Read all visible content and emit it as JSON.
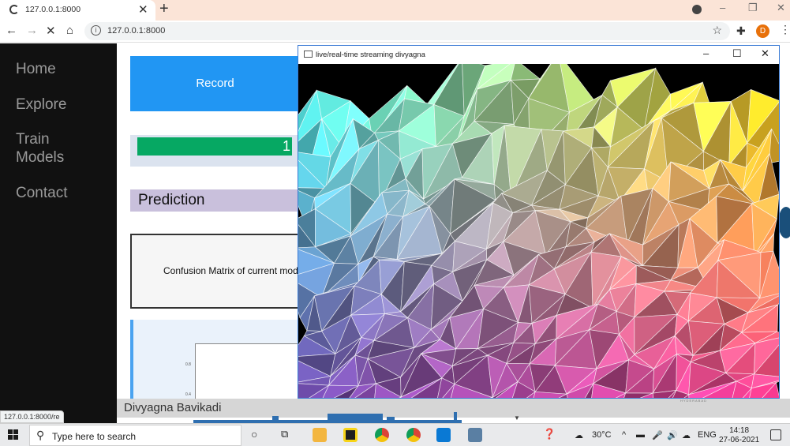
{
  "browser": {
    "tab_title": "127.0.0.1:8000",
    "url": "127.0.0.1:8000",
    "avatar_letter": "D",
    "status_url": "127.0.0.1:8000/re"
  },
  "sidebar": {
    "items": [
      {
        "label": "Home"
      },
      {
        "label": "Explore"
      },
      {
        "label": "Train"
      },
      {
        "label": "Models"
      },
      {
        "label": "Contact"
      }
    ]
  },
  "main": {
    "record_label": "Record",
    "progress_text": "1",
    "progress_fraction": 0.95,
    "prediction_title": "Prediction",
    "confusion_text": "Confusion Matrix of current model",
    "plot_ticks": [
      "0.8",
      "0.4"
    ],
    "footer_name": "Divyagna Bavikadi",
    "logo_fragment": "HYDERABAD"
  },
  "overlay_window": {
    "title": "live/real-time streaming divyagna"
  },
  "taskbar": {
    "search_placeholder": "Type here to search",
    "temperature": "30°C",
    "language": "ENG",
    "time": "14:18",
    "date": "27-06-2021"
  },
  "colors": {
    "record": "#2196f3",
    "progress": "#06a863",
    "prediction_bg": "#c9c0dc",
    "sidebar_bg": "#111111"
  }
}
